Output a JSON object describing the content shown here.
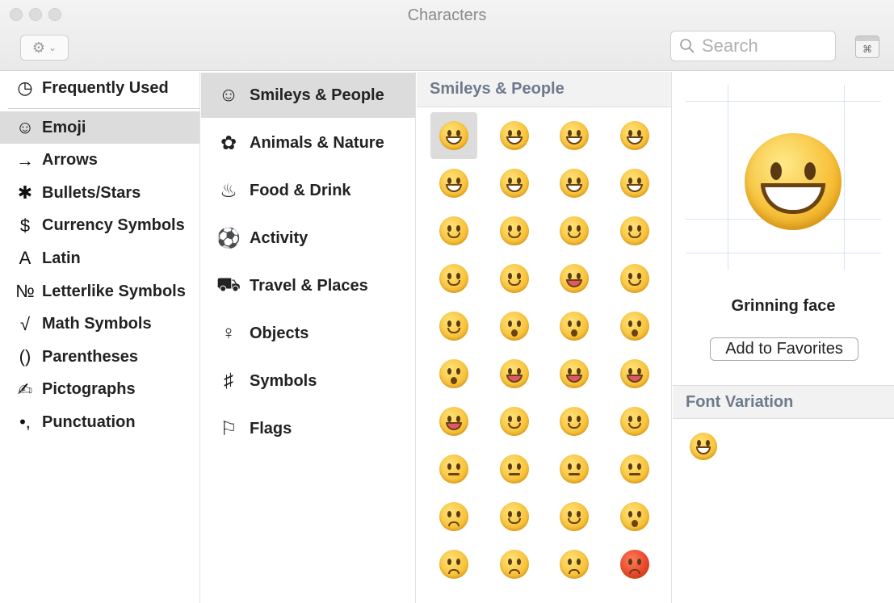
{
  "window": {
    "title": "Characters"
  },
  "toolbar": {
    "search_placeholder": "Search"
  },
  "sidebar": {
    "frequently_used": "Frequently Used",
    "items": [
      {
        "label": "Emoji",
        "icon": "smiley-icon",
        "glyph": "☺",
        "selected": true
      },
      {
        "label": "Arrows",
        "icon": "arrow-icon",
        "glyph": "→"
      },
      {
        "label": "Bullets/Stars",
        "icon": "asterisk-icon",
        "glyph": "✱"
      },
      {
        "label": "Currency Symbols",
        "icon": "dollar-icon",
        "glyph": "$"
      },
      {
        "label": "Latin",
        "icon": "latin-a-icon",
        "glyph": "A"
      },
      {
        "label": "Letterlike Symbols",
        "icon": "numero-icon",
        "glyph": "№"
      },
      {
        "label": "Math Symbols",
        "icon": "sqrt-icon",
        "glyph": "√"
      },
      {
        "label": "Parentheses",
        "icon": "parentheses-icon",
        "glyph": "()"
      },
      {
        "label": "Pictographs",
        "icon": "writing-hand-icon",
        "glyph": "✍"
      },
      {
        "label": "Punctuation",
        "icon": "punctuation-icon",
        "glyph": "•,"
      }
    ]
  },
  "categories": {
    "items": [
      {
        "label": "Smileys & People",
        "icon": "smiley-icon",
        "glyph": "☺",
        "selected": true
      },
      {
        "label": "Animals & Nature",
        "icon": "bear-icon",
        "glyph": "✿"
      },
      {
        "label": "Food & Drink",
        "icon": "cake-icon",
        "glyph": "♨"
      },
      {
        "label": "Activity",
        "icon": "soccer-ball-icon",
        "glyph": "⚽"
      },
      {
        "label": "Travel & Places",
        "icon": "car-icon",
        "glyph": "⛟"
      },
      {
        "label": "Objects",
        "icon": "lightbulb-icon",
        "glyph": "♀"
      },
      {
        "label": "Symbols",
        "icon": "symbols-icon",
        "glyph": "♯"
      },
      {
        "label": "Flags",
        "icon": "flag-icon",
        "glyph": "⚐"
      }
    ]
  },
  "grid": {
    "section_title": "Smileys & People",
    "emojis": [
      "grinning",
      "grimacing-grin",
      "grin",
      "tears-of-joy",
      "smiley",
      "smile",
      "sweat-smile",
      "laughing",
      "innocent",
      "wink",
      "blush",
      "slightly-smiling",
      "upside-down",
      "relaxed",
      "yum",
      "relieved",
      "heart-eyes",
      "kissing-heart",
      "kissing",
      "kissing-smiling-eyes",
      "kissing-closed-eyes",
      "winking-tongue",
      "squinting-tongue",
      "tongue",
      "money-mouth",
      "nerd",
      "sunglasses",
      "hugging",
      "smirk",
      "no-mouth",
      "neutral",
      "expressionless",
      "unamused",
      "eye-roll",
      "thinking",
      "flushed",
      "disappointed",
      "worried",
      "angry",
      "pouting"
    ]
  },
  "detail": {
    "char_name": "Grinning face",
    "add_favorites": "Add to Favorites",
    "font_variation": "Font Variation"
  },
  "colors": {
    "selection": "#dcdcdc",
    "section_text": "#6d7a8c",
    "emoji_yellow": "#f7c23a",
    "emoji_red": "#e8442a"
  }
}
